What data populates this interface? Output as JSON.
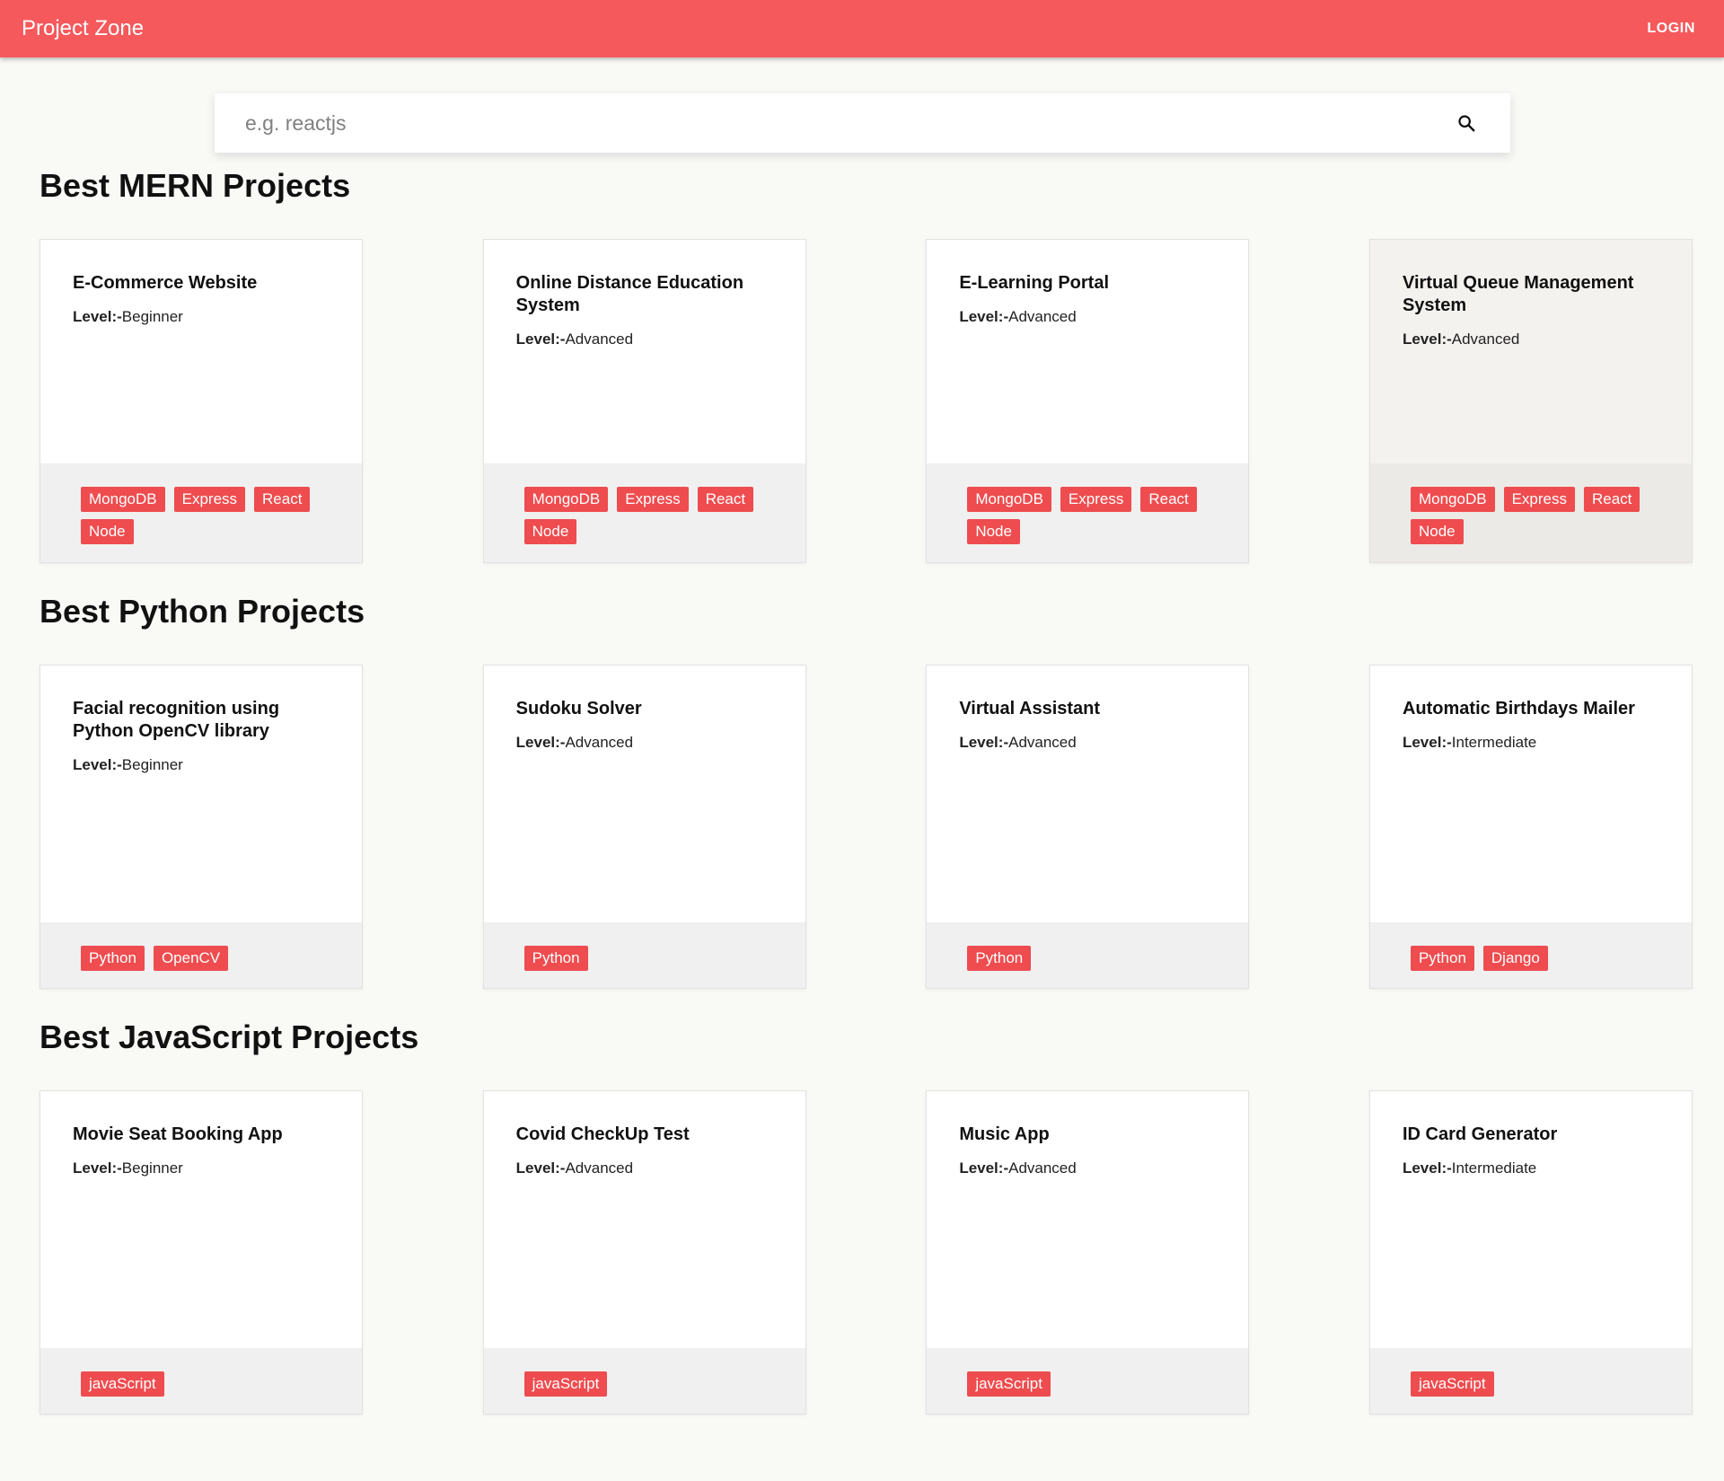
{
  "header": {
    "brand": "Project Zone",
    "login_label": "LOGIN"
  },
  "search": {
    "placeholder": "e.g. reactjs"
  },
  "level_label": "Level:-",
  "sections": [
    {
      "title": "Best MERN Projects",
      "cards": [
        {
          "title": "E-Commerce Website",
          "level": "Beginner",
          "tags": [
            "MongoDB",
            "Express",
            "React",
            "Node"
          ]
        },
        {
          "title": "Online Distance Education System",
          "level": "Advanced",
          "tags": [
            "MongoDB",
            "Express",
            "React",
            "Node"
          ]
        },
        {
          "title": "E-Learning Portal",
          "level": "Advanced",
          "tags": [
            "MongoDB",
            "Express",
            "React",
            "Node"
          ]
        },
        {
          "title": "Virtual Queue Management System",
          "level": "Advanced",
          "tags": [
            "MongoDB",
            "Express",
            "React",
            "Node"
          ]
        }
      ]
    },
    {
      "title": "Best Python Projects",
      "cards": [
        {
          "title": "Facial recognition using Python OpenCV library",
          "level": "Beginner",
          "tags": [
            "Python",
            "OpenCV"
          ]
        },
        {
          "title": "Sudoku Solver",
          "level": "Advanced",
          "tags": [
            "Python"
          ]
        },
        {
          "title": "Virtual Assistant",
          "level": "Advanced",
          "tags": [
            "Python"
          ]
        },
        {
          "title": "Automatic Birthdays Mailer",
          "level": "Intermediate",
          "tags": [
            "Python",
            "Django"
          ]
        }
      ]
    },
    {
      "title": "Best JavaScript Projects",
      "cards": [
        {
          "title": "Movie Seat Booking App",
          "level": "Beginner",
          "tags": [
            "javaScript"
          ]
        },
        {
          "title": "Covid CheckUp Test",
          "level": "Advanced",
          "tags": [
            "javaScript"
          ]
        },
        {
          "title": "Music App",
          "level": "Advanced",
          "tags": [
            "javaScript"
          ]
        },
        {
          "title": "ID Card Generator",
          "level": "Intermediate",
          "tags": [
            "javaScript"
          ]
        }
      ]
    }
  ],
  "colors": {
    "accent": "#f5595c",
    "tag": "#ee4c4f",
    "background": "#f9f9f6"
  },
  "icons": {
    "search": "search-icon"
  }
}
